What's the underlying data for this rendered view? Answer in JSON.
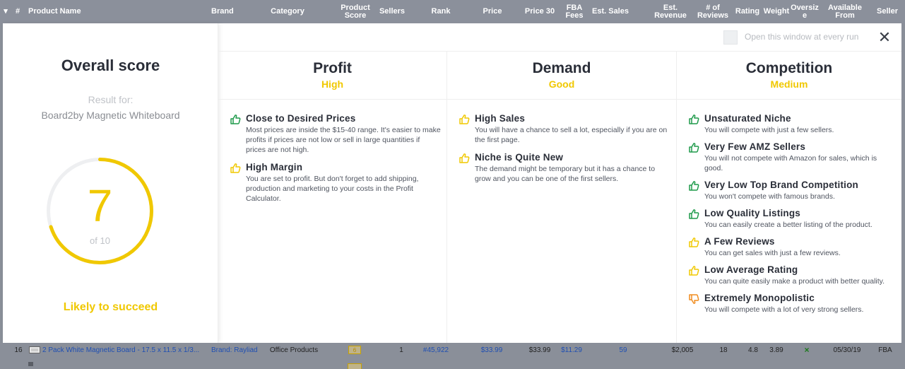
{
  "table": {
    "headers": {
      "num": "#",
      "product_name": "Product Name",
      "brand": "Brand",
      "category": "Category",
      "product_score": "Product Score",
      "sellers": "Sellers",
      "rank": "Rank",
      "price": "Price",
      "price30": "Price 30",
      "fba_fees": "FBA Fees",
      "est_sales": "Est. Sales",
      "est_revenue": "Est. Revenue",
      "reviews": "# of Reviews",
      "rating": "Rating",
      "weight": "Weight",
      "oversize": "Oversiz e",
      "available_from": "Available From",
      "seller": "Seller"
    },
    "row": {
      "num": "16",
      "product": "2 Pack White Magnetic Board - 17.5 x 11.5 x 1/3...",
      "brand": "Brand: Rayliad",
      "category": "Office Products",
      "score": "6",
      "sellers": "1",
      "rank": "#45,922",
      "price": "$33.99",
      "price30": "$33.99",
      "fba_fees": "$11.29",
      "est_sales": "59",
      "est_revenue": "$2,005",
      "reviews": "18",
      "rating": "4.8",
      "weight": "3.89",
      "oversize": "×",
      "available_from": "05/30/19",
      "seller": "FBA"
    }
  },
  "modal": {
    "open_every_run_label": "Open this window at every run",
    "close_label": "✕",
    "overall": {
      "title": "Overall score",
      "result_for": "Result for:",
      "product": "Board2by Magnetic Whiteboard",
      "score": "7",
      "score_fraction": 0.7,
      "of_label": "of 10",
      "verdict": "Likely to succeed"
    },
    "columns": [
      {
        "title": "Profit",
        "rating": "High",
        "items": [
          {
            "icon": "thumbs-up-green",
            "title": "Close to Desired Prices",
            "desc": "Most prices are inside the $15-40 range. It's easier to make profits if prices are not low or sell in large quantities if prices are not high."
          },
          {
            "icon": "thumbs-up-yellow",
            "title": "High Margin",
            "desc": "You are set to profit. But don't forget to add shipping, production and marketing to your costs in the Profit Calculator."
          }
        ]
      },
      {
        "title": "Demand",
        "rating": "Good",
        "items": [
          {
            "icon": "thumbs-up-yellow",
            "title": "High Sales",
            "desc": "You will have a chance to sell a lot, especially if you are on the first page."
          },
          {
            "icon": "thumbs-up-yellow",
            "title": "Niche is Quite New",
            "desc": "The demand might be temporary but it has a chance to grow and you can be one of the first sellers."
          }
        ]
      },
      {
        "title": "Competition",
        "rating": "Medium",
        "items": [
          {
            "icon": "thumbs-up-green",
            "title": "Unsaturated Niche",
            "desc": "You will compete with just a few sellers."
          },
          {
            "icon": "thumbs-up-green",
            "title": "Very Few AMZ Sellers",
            "desc": "You will not compete with Amazon for sales, which is good."
          },
          {
            "icon": "thumbs-up-green",
            "title": "Very Low Top Brand Competition",
            "desc": "You won't compete with famous brands."
          },
          {
            "icon": "thumbs-up-green",
            "title": "Low Quality Listings",
            "desc": "You can easily create a better listing of the product."
          },
          {
            "icon": "thumbs-up-yellow",
            "title": "A Few Reviews",
            "desc": "You can get sales with just a few reviews."
          },
          {
            "icon": "thumbs-up-yellow",
            "title": "Low Average Rating",
            "desc": "You can quite easily make a product with better quality."
          },
          {
            "icon": "thumbs-down-orange",
            "title": "Extremely Monopolistic",
            "desc": "You will compete with a lot of very strong sellers."
          }
        ]
      }
    ]
  },
  "colors": {
    "accent_yellow": "#f0c800",
    "icon_green": "#1e9a4a",
    "icon_yellow": "#f0c800",
    "icon_orange": "#f08c1e",
    "header_gray": "#8b909b"
  }
}
